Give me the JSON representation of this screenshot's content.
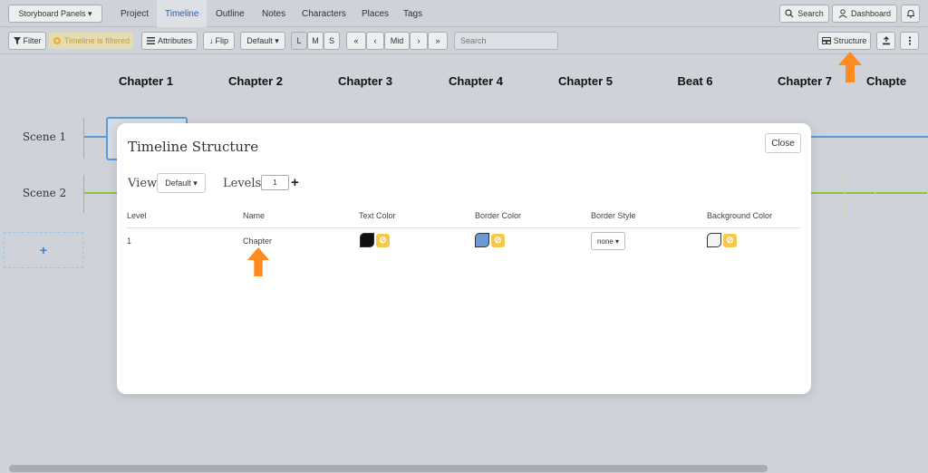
{
  "topnav": {
    "project_menu": "Storyboard Panels ▾",
    "tabs": [
      {
        "label": "Project"
      },
      {
        "label": "Timeline"
      },
      {
        "label": "Outline"
      },
      {
        "label": "Notes"
      },
      {
        "label": "Characters"
      },
      {
        "label": "Places"
      },
      {
        "label": "Tags"
      }
    ],
    "search_label": "Search",
    "dashboard_label": "Dashboard"
  },
  "toolbar": {
    "filter_label": "Filter",
    "filtered_badge": "Timeline is filtered",
    "attributes_label": "Attributes",
    "flip_label": "Flip",
    "default_label": "Default ▾",
    "size_l": "L",
    "size_m": "M",
    "size_s": "S",
    "nav_first": "«",
    "nav_prev": "‹",
    "nav_mid": "Mid",
    "nav_next": "›",
    "nav_last": "»",
    "search_placeholder": "Search",
    "structure_label": "Structure"
  },
  "timeline": {
    "headers": [
      "Chapter 1",
      "Chapter 2",
      "Chapter 3",
      "Chapter 4",
      "Chapter 5",
      "Beat 6",
      "Chapter 7",
      "Chapte"
    ],
    "scenes": [
      "Scene 1",
      "Scene 2"
    ],
    "add_scene": "+"
  },
  "modal": {
    "title": "Timeline Structure",
    "close_label": "Close",
    "view_label": "View",
    "view_value": "Default ▾",
    "levels_label": "Levels",
    "levels_value": "1",
    "columns": [
      "Level",
      "Name",
      "Text Color",
      "Border Color",
      "Border Style",
      "Background Color"
    ],
    "row": {
      "level": "1",
      "name": "Chapter",
      "text_color": "#111111",
      "border_color": "#6b9bd2",
      "border_style": "none ▾",
      "background_color": "#f5f5f5"
    }
  },
  "colors": {
    "accent": "#ff8a1f",
    "nav_active": "#2a5db0",
    "scene1_line": "#5b9bd5",
    "scene2_line": "#8cc63f",
    "none_icon": "#f5c84b"
  }
}
